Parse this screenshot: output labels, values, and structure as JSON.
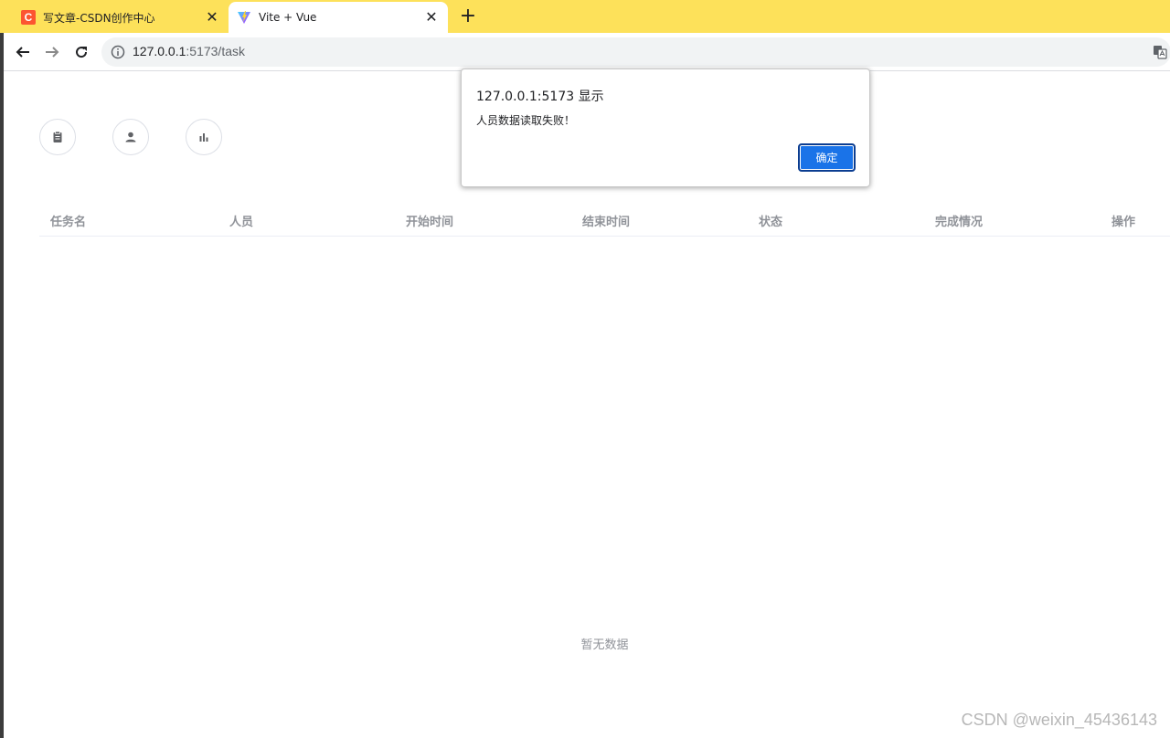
{
  "browser": {
    "tabs": [
      {
        "title": "写文章-CSDN创作中心",
        "icon": "csdn-icon",
        "favicon_letter": "C",
        "active": false
      },
      {
        "title": "Vite + Vue",
        "icon": "vite-icon",
        "active": true
      }
    ],
    "new_tab_label": "+",
    "url": {
      "host": "127.0.0.1",
      "path": ":5173/task"
    }
  },
  "nav_icons": [
    {
      "name": "task-icon"
    },
    {
      "name": "person-icon"
    },
    {
      "name": "chart-icon"
    }
  ],
  "table": {
    "columns": [
      "任务名",
      "人员",
      "开始时间",
      "结束时间",
      "状态",
      "完成情况",
      "操作"
    ],
    "empty_text": "暂无数据"
  },
  "dialog": {
    "title": "127.0.0.1:5173 显示",
    "message": "人员数据读取失败！",
    "ok_label": "确定"
  },
  "watermark": "CSDN @weixin_45436143",
  "colors": {
    "tabbar": "#fde15a",
    "accent": "#1a73e8",
    "csdn": "#fc5531"
  }
}
